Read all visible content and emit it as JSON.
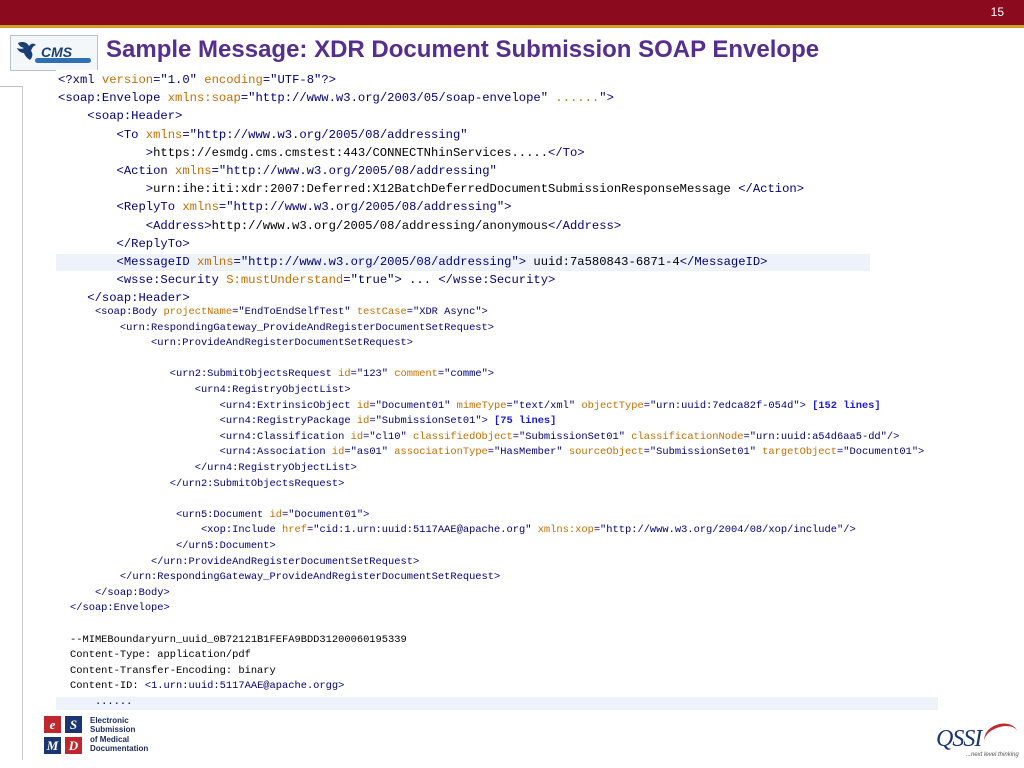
{
  "slide": {
    "number": "15",
    "title": "Sample Message: XDR Document Submission SOAP Envelope"
  },
  "logos": {
    "cms": {
      "text": "CMS",
      "icon": "eagle-icon"
    },
    "esmd": {
      "letters": [
        "e",
        "S",
        "M",
        "D"
      ],
      "lines": [
        "Electronic",
        "Submission",
        "of Medical",
        "Documentation"
      ]
    },
    "qssi": {
      "name": "QSSI",
      "tagline": "...next level thinking"
    }
  },
  "colors": {
    "topbar": "#8c0a1e",
    "title": "#552e8f",
    "tag": "#00007a",
    "attribute": "#c86e00",
    "esmd_red": "#c0272d",
    "esmd_blue": "#1a3570"
  },
  "code": {
    "header_lines": [
      [
        [
          "tg",
          "<?xml "
        ],
        [
          "at",
          "version"
        ],
        [
          "tg",
          "=\"1.0\" "
        ],
        [
          "at",
          "encoding"
        ],
        [
          "tg",
          "=\"UTF-8\"?>"
        ]
      ],
      [
        [
          "tg",
          "<soap:Envelope "
        ],
        [
          "at",
          "xmlns:soap"
        ],
        [
          "vl",
          "=\"http://www.w3.org/2003/05/soap-envelope\" "
        ],
        [
          "at",
          "......"
        ],
        [
          "tg",
          "\">"
        ]
      ],
      [
        [
          "tg",
          "    <soap:Header>"
        ]
      ],
      [
        [
          "tg",
          "        <To "
        ],
        [
          "at",
          "xmlns"
        ],
        [
          "vl",
          "=\"http://www.w3.org/2005/08/addressing\""
        ]
      ],
      [
        [
          "tg",
          "            >"
        ],
        [
          "tx",
          "https://esmdg.cms.cmstest:443/CONNECTNhinServices....."
        ],
        [
          "tg",
          "</To>"
        ]
      ],
      [
        [
          "tg",
          "        <Action "
        ],
        [
          "at",
          "xmlns"
        ],
        [
          "vl",
          "=\"http://www.w3.org/2005/08/addressing\""
        ]
      ],
      [
        [
          "tg",
          "            >"
        ],
        [
          "tx",
          "urn:ihe:iti:xdr:2007:Deferred:X12BatchDeferredDocumentSubmissionResponseMessage "
        ],
        [
          "tg",
          "</Action>"
        ]
      ],
      [
        [
          "tg",
          "        <ReplyTo "
        ],
        [
          "at",
          "xmlns"
        ],
        [
          "vl",
          "=\"http://www.w3.org/2005/08/addressing\">"
        ]
      ],
      [
        [
          "tg",
          "            <Address>"
        ],
        [
          "tx",
          "http://www.w3.org/2005/08/addressing/anonymous"
        ],
        [
          "tg",
          "</Address>"
        ]
      ],
      [
        [
          "tg",
          "        </ReplyTo>"
        ]
      ],
      [
        [
          "tg",
          "        <MessageID "
        ],
        [
          "at",
          "xmlns"
        ],
        [
          "vl",
          "=\"http://www.w3.org/2005/08/addressing\"> "
        ],
        [
          "tx",
          "uuid:7a580843-6871-4"
        ],
        [
          "tg",
          "</MessageID>"
        ]
      ],
      [
        [
          "tg",
          "        <wsse:Security "
        ],
        [
          "at",
          "S:mustUnderstand"
        ],
        [
          "vl",
          "=\"true\"> "
        ],
        [
          "tx",
          "... "
        ],
        [
          "tg",
          "</wsse:Security>"
        ]
      ],
      [
        [
          "tg",
          "    </soap:Header>"
        ]
      ]
    ],
    "body_lines": [
      [
        [
          "tg",
          "    <soap:Body "
        ],
        [
          "at",
          "projectName"
        ],
        [
          "vl",
          "=\"EndToEndSelfTest\" "
        ],
        [
          "at",
          "testCase"
        ],
        [
          "vl",
          "=\"XDR Async\">"
        ]
      ],
      [
        [
          "tg",
          "        <urn:RespondingGateway_ProvideAndRegisterDocumentSetRequest>"
        ]
      ],
      [
        [
          "tg",
          "             <urn:ProvideAndRegisterDocumentSetRequest>"
        ]
      ],
      [],
      [
        [
          "tg",
          "                <urn2:SubmitObjectsRequest "
        ],
        [
          "at",
          "id"
        ],
        [
          "vl",
          "=\"123\" "
        ],
        [
          "at",
          "comment"
        ],
        [
          "vl",
          "=\"comme\">"
        ]
      ],
      [
        [
          "tg",
          "                    <urn4:RegistryObjectList>"
        ]
      ],
      [
        [
          "tg",
          "                        <urn4:ExtrinsicObject "
        ],
        [
          "at",
          "id"
        ],
        [
          "vl",
          "=\"Document01\" "
        ],
        [
          "at",
          "mimeType"
        ],
        [
          "vl",
          "=\"text/xml\" "
        ],
        [
          "at",
          "objectType"
        ],
        [
          "vl",
          "=\"urn:uuid:7edca82f-054d\"> "
        ],
        [
          "bl",
          "[152 lines]"
        ]
      ],
      [
        [
          "tg",
          "                        <urn4:RegistryPackage "
        ],
        [
          "at",
          "id"
        ],
        [
          "vl",
          "=\"SubmissionSet01\"> "
        ],
        [
          "bl",
          "[75 lines]"
        ]
      ],
      [
        [
          "tg",
          "                        <urn4:Classification "
        ],
        [
          "at",
          "id"
        ],
        [
          "vl",
          "=\"cl10\" "
        ],
        [
          "at",
          "classifiedObject"
        ],
        [
          "vl",
          "=\"SubmissionSet01\" "
        ],
        [
          "at",
          "classificationNode"
        ],
        [
          "vl",
          "=\"urn:uuid:a54d6aa5-dd\"/>"
        ]
      ],
      [
        [
          "tg",
          "                        <urn4:Association "
        ],
        [
          "at",
          "id"
        ],
        [
          "vl",
          "=\"as01\" "
        ],
        [
          "at",
          "associationType"
        ],
        [
          "vl",
          "=\"HasMember\" "
        ],
        [
          "at",
          "sourceObject"
        ],
        [
          "vl",
          "=\"SubmissionSet01\" "
        ],
        [
          "at",
          "targetObject"
        ],
        [
          "vl",
          "=\"Document01\">"
        ]
      ],
      [
        [
          "tg",
          "                    </urn4:RegistryObjectList>"
        ]
      ],
      [
        [
          "tg",
          "                </urn2:SubmitObjectsRequest>"
        ]
      ],
      [],
      [
        [
          "tg",
          "                 <urn5:Document "
        ],
        [
          "at",
          "id"
        ],
        [
          "vl",
          "=\"Document01\">"
        ]
      ],
      [
        [
          "tg",
          "                     <xop:Include "
        ],
        [
          "at",
          "href"
        ],
        [
          "vl",
          "=\"cid:1.urn:uuid:5117AAE@apache.org\" "
        ],
        [
          "at",
          "xmlns:xop"
        ],
        [
          "vl",
          "=\"http://www.w3.org/2004/08/xop/include\"/>"
        ]
      ],
      [
        [
          "tg",
          "                 </urn5:Document>"
        ]
      ],
      [
        [
          "tg",
          "             </urn:ProvideAndRegisterDocumentSetRequest>"
        ]
      ],
      [
        [
          "tg",
          "        </urn:RespondingGateway_ProvideAndRegisterDocumentSetRequest>"
        ]
      ],
      [
        [
          "tg",
          "    </soap:Body>"
        ]
      ],
      [
        [
          "tg",
          "</soap:Envelope>"
        ]
      ],
      [],
      [
        [
          "tx",
          "--MIMEBoundaryurn_uuid_0B72121B1FEFA9BDD31200060195339"
        ]
      ],
      [
        [
          "tx",
          "Content-Type: application/pdf"
        ]
      ],
      [
        [
          "tx",
          "Content-Transfer-Encoding: binary"
        ]
      ],
      [
        [
          "tx",
          "Content-ID: "
        ],
        [
          "tg",
          "<1.urn:uuid:5117AAE@apache.orgg>"
        ]
      ],
      [
        [
          "tx",
          "    ......"
        ]
      ]
    ]
  }
}
